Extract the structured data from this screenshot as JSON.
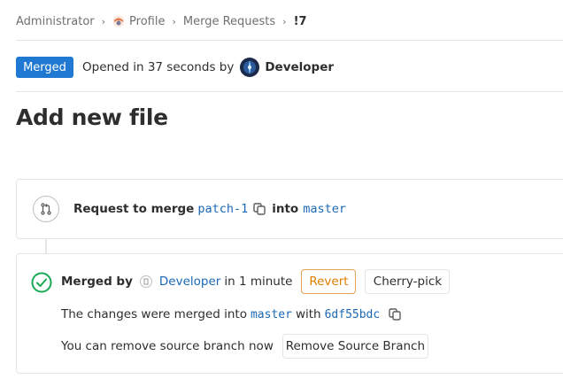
{
  "breadcrumb": {
    "items": [
      "Administrator",
      "Profile",
      "Merge Requests",
      "!7"
    ],
    "separator": "›"
  },
  "header": {
    "status": "Merged",
    "opened_prefix": "Opened in 37 seconds by",
    "author": "Developer"
  },
  "title": "Add new file",
  "request": {
    "prefix": "Request to merge",
    "source_branch": "patch-1",
    "into": "into",
    "target_branch": "master"
  },
  "merged": {
    "by_label": "Merged by",
    "user": "Developer",
    "time": "in 1 minute",
    "revert_label": "Revert",
    "cherry_pick_label": "Cherry-pick",
    "changes_prefix": "The changes were merged into",
    "target_branch": "master",
    "with": "with",
    "commit": "6df55bdc",
    "remove_text": "You can remove source branch now",
    "remove_button_label": "Remove Source Branch"
  },
  "colors": {
    "accent": "#1f78d1",
    "link": "#1b69b6",
    "success": "#1aaa55",
    "warning": "#de7e00"
  },
  "icons": {
    "project_avatar": "profile-avatar-icon",
    "author_avatar": "developer-avatar-icon",
    "merge_request": "merge-request-icon",
    "copy": "copy-icon",
    "success": "check-circle-icon"
  }
}
